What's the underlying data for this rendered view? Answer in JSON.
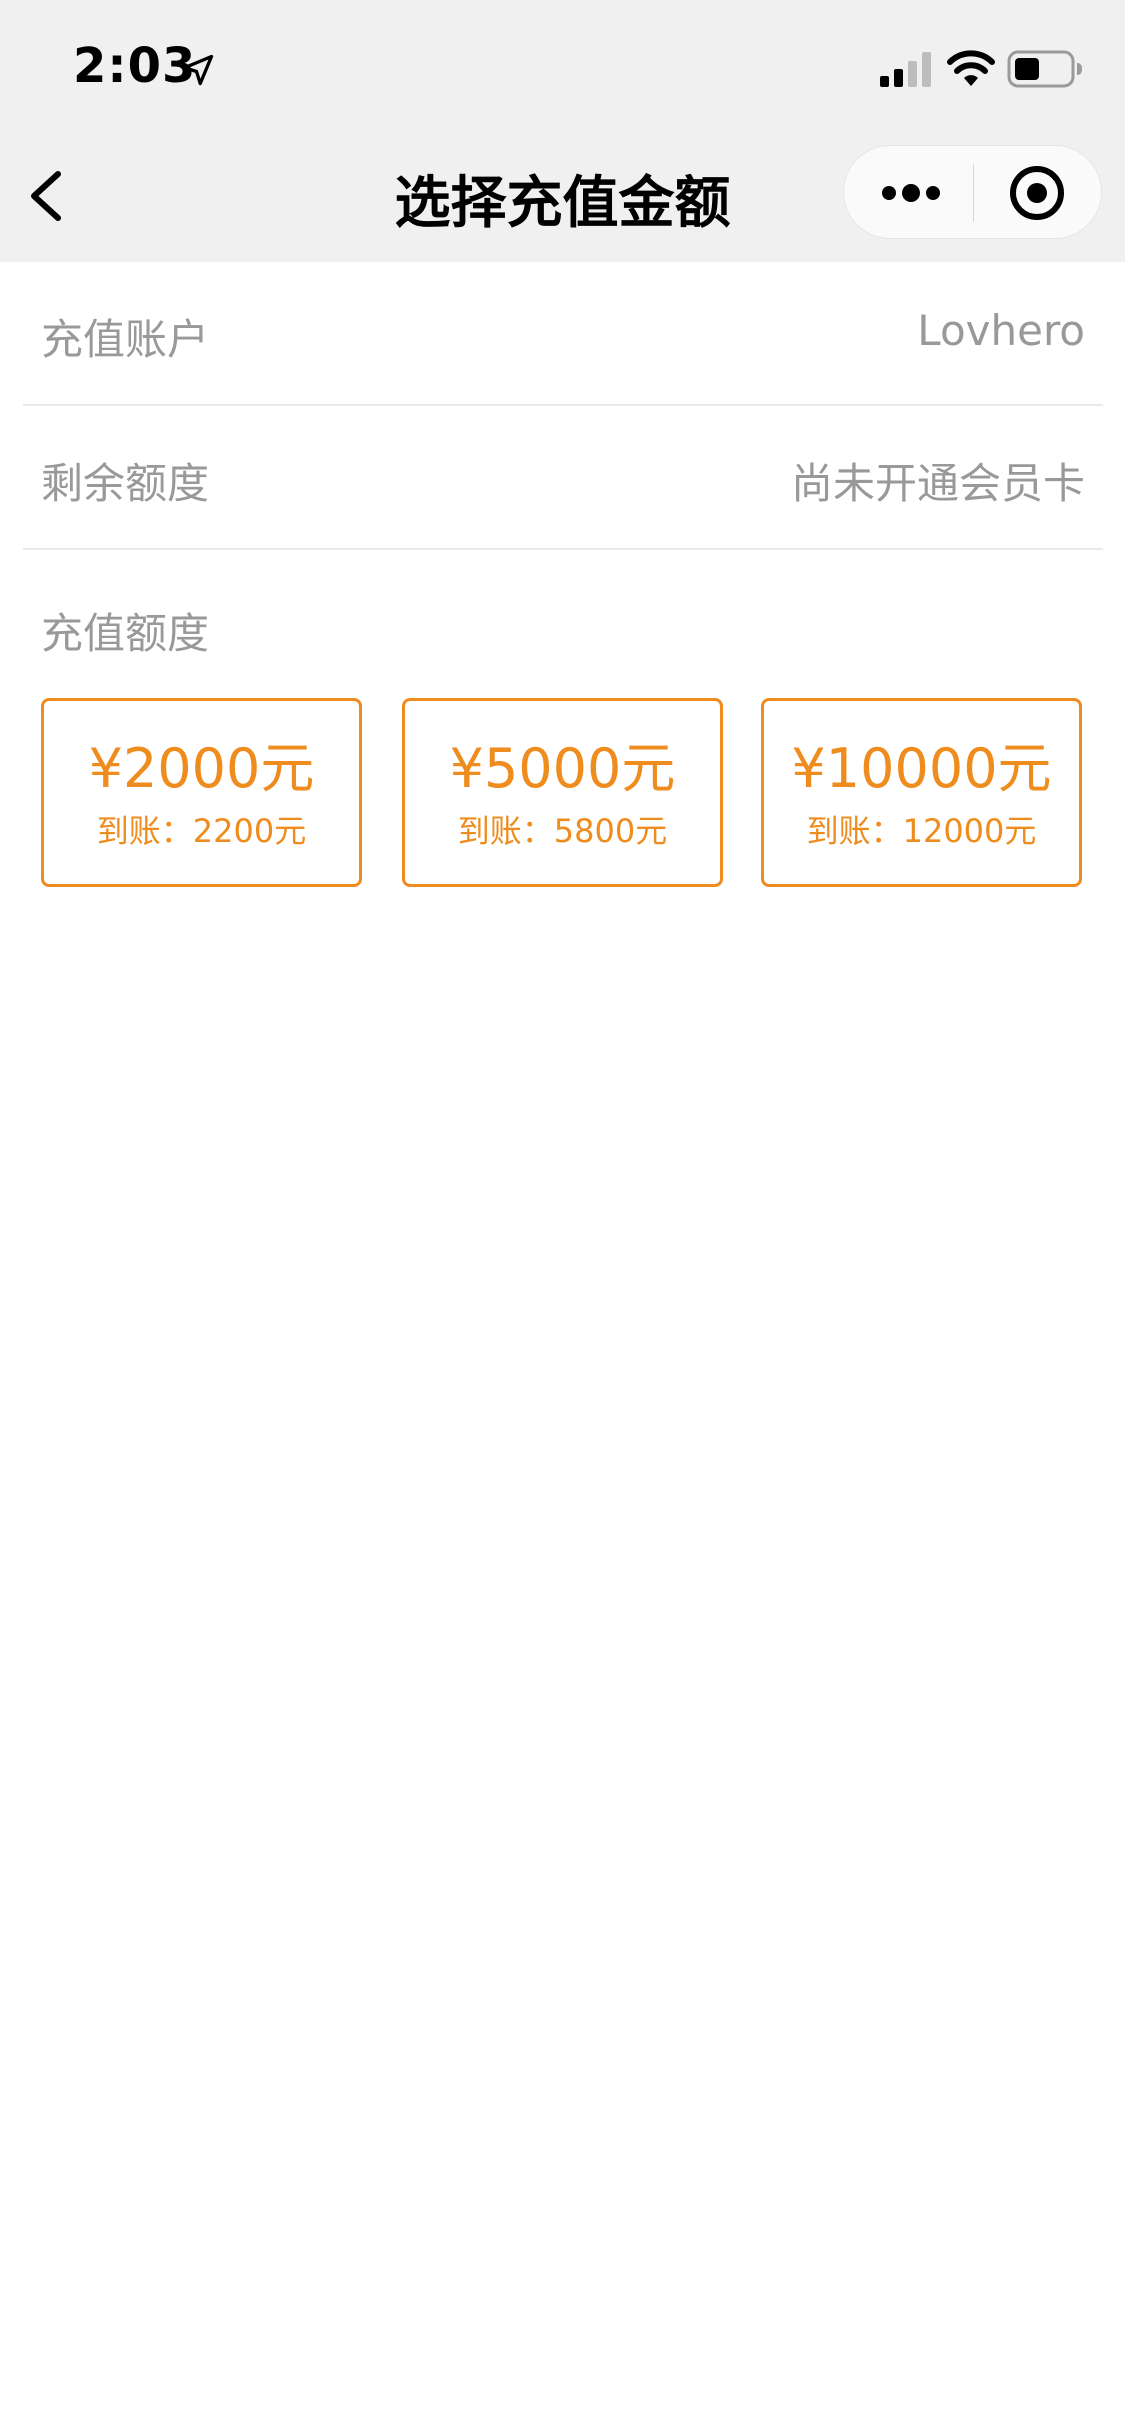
{
  "status_bar": {
    "time": "2:03"
  },
  "nav": {
    "title": "选择充值金额"
  },
  "rows": [
    {
      "label": "充值账户",
      "value": "Lovhero"
    },
    {
      "label": "剩余额度",
      "value": "尚未开通会员卡"
    }
  ],
  "recharge": {
    "title": "充值额度",
    "options": [
      {
        "amount": "¥2000元",
        "credit": "到账：2200元"
      },
      {
        "amount": "¥5000元",
        "credit": "到账：5800元"
      },
      {
        "amount": "¥10000元",
        "credit": "到账：12000元"
      }
    ]
  },
  "colors": {
    "accent": "#ef8c1e",
    "muted_text": "#999999",
    "header_bg": "#f0f0f0"
  }
}
